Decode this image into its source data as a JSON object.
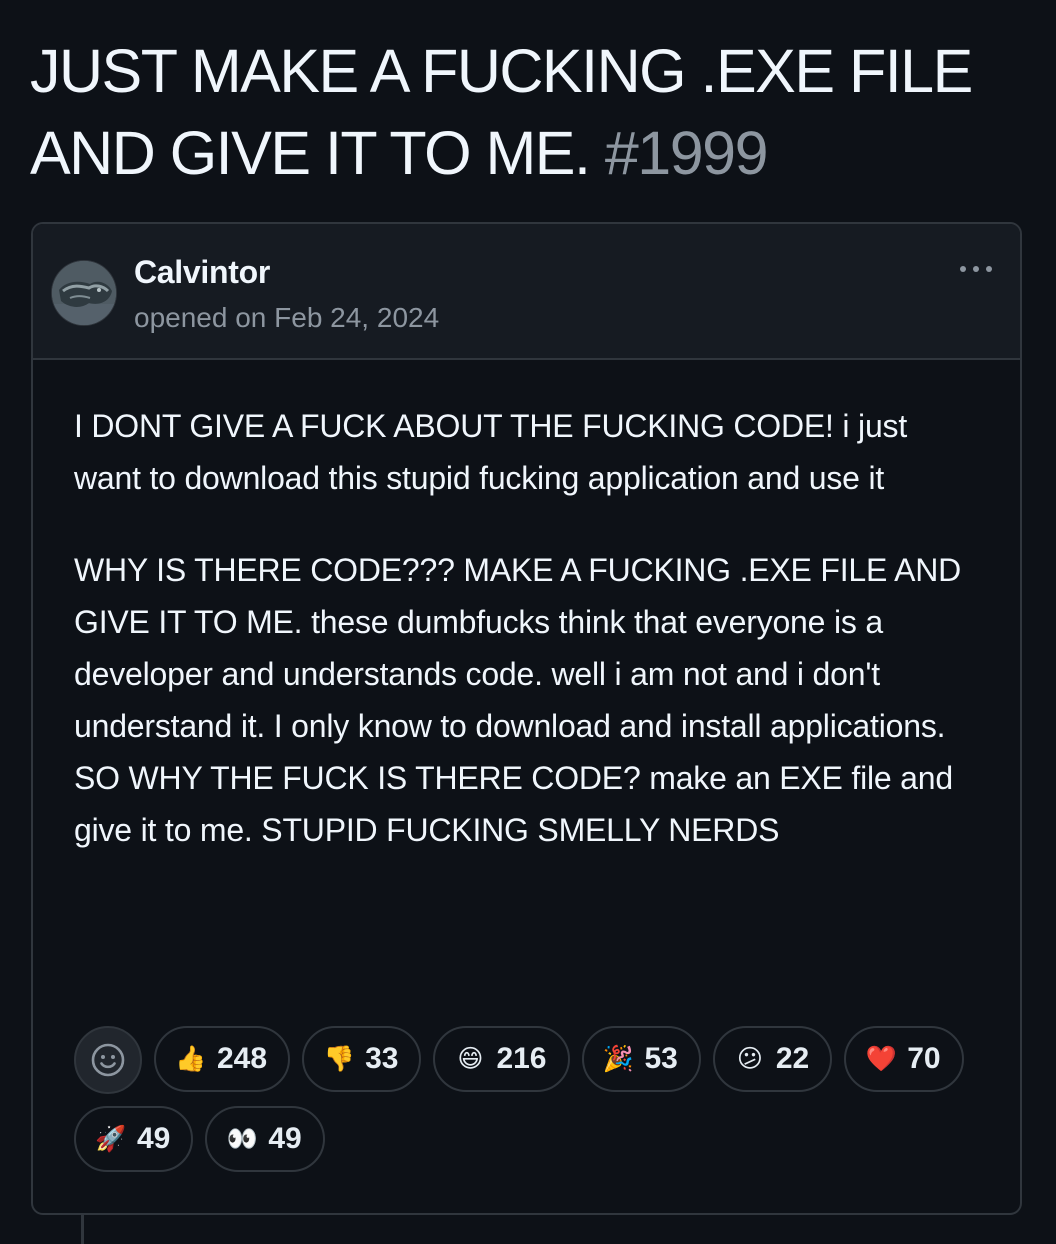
{
  "issue": {
    "title": "JUST MAKE A FUCKING .EXE FILE AND GIVE IT TO ME.",
    "number": "#1999"
  },
  "comment": {
    "author": "Calvintor",
    "opened_text": "opened on Feb 24, 2024",
    "paragraphs": [
      "I DONT GIVE A FUCK ABOUT THE FUCKING CODE! i just want to download this stupid fucking application and use it",
      "WHY IS THERE CODE??? MAKE A FUCKING .EXE FILE AND GIVE IT TO ME. these dumbfucks think that everyone is a developer and understands code. well i am not and i don't understand it. I only know to download and install applications. SO WHY THE FUCK IS THERE CODE? make an EXE file and give it to me. STUPID FUCKING SMELLY NERDS"
    ],
    "reactions": [
      {
        "icon": "thumbs-up-icon",
        "emoji": "👍",
        "count": "248"
      },
      {
        "icon": "thumbs-down-icon",
        "emoji": "👎",
        "count": "33"
      },
      {
        "icon": "laugh-icon",
        "emoji": "😄",
        "count": "216"
      },
      {
        "icon": "hooray-icon",
        "emoji": "🎉",
        "count": "53"
      },
      {
        "icon": "confused-icon",
        "emoji": "😕",
        "count": "22"
      },
      {
        "icon": "heart-icon",
        "emoji": "❤️",
        "count": "70"
      },
      {
        "icon": "rocket-icon",
        "emoji": "🚀",
        "count": "49"
      },
      {
        "icon": "eyes-icon",
        "emoji": "👀",
        "count": "49"
      }
    ]
  },
  "colors": {
    "background": "#0d1117",
    "header_background": "#161b22",
    "border": "#30363d",
    "text": "#f0f6fc",
    "muted_text": "#8d96a0"
  }
}
